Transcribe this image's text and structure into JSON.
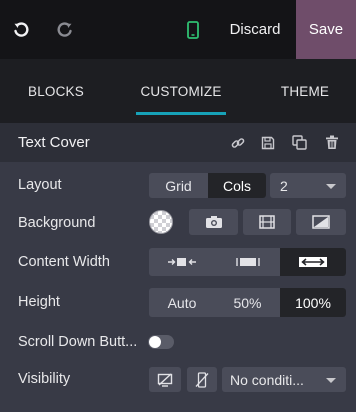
{
  "topbar": {
    "undo_icon": "undo-icon",
    "redo_icon": "redo-icon",
    "mobile_icon": "mobile-phone-icon",
    "discard_label": "Discard",
    "save_label": "Save"
  },
  "tabs": [
    {
      "label": "BLOCKS"
    },
    {
      "label": "CUSTOMIZE",
      "active": true
    },
    {
      "label": "THEME"
    }
  ],
  "section": {
    "title": "Text Cover",
    "icons": [
      "link-icon",
      "save-icon",
      "clone-icon",
      "trash-icon"
    ]
  },
  "rows": {
    "layout": {
      "label": "Layout",
      "options": [
        "Grid",
        "Cols"
      ],
      "selected": "Cols",
      "columns_value": "2"
    },
    "background": {
      "label": "Background",
      "icons": [
        "camera-icon",
        "film-icon",
        "gradient-icon"
      ]
    },
    "content_width": {
      "label": "Content Width",
      "icons": [
        "narrow-width-icon",
        "regular-width-icon",
        "full-width-icon"
      ],
      "selected_index": 2
    },
    "height": {
      "label": "Height",
      "options": [
        "Auto",
        "50%",
        "100%"
      ],
      "selected": "100%"
    },
    "scroll_down": {
      "label": "Scroll Down Butt...",
      "enabled": false
    },
    "visibility": {
      "label": "Visibility",
      "icons": [
        "hide-desktop-icon",
        "hide-mobile-icon"
      ],
      "condition_value": "No conditi..."
    }
  },
  "colors": {
    "accent": "#17a2b8",
    "save_bg": "#6f4d6a",
    "mobile_icon": "#2fbf71"
  }
}
